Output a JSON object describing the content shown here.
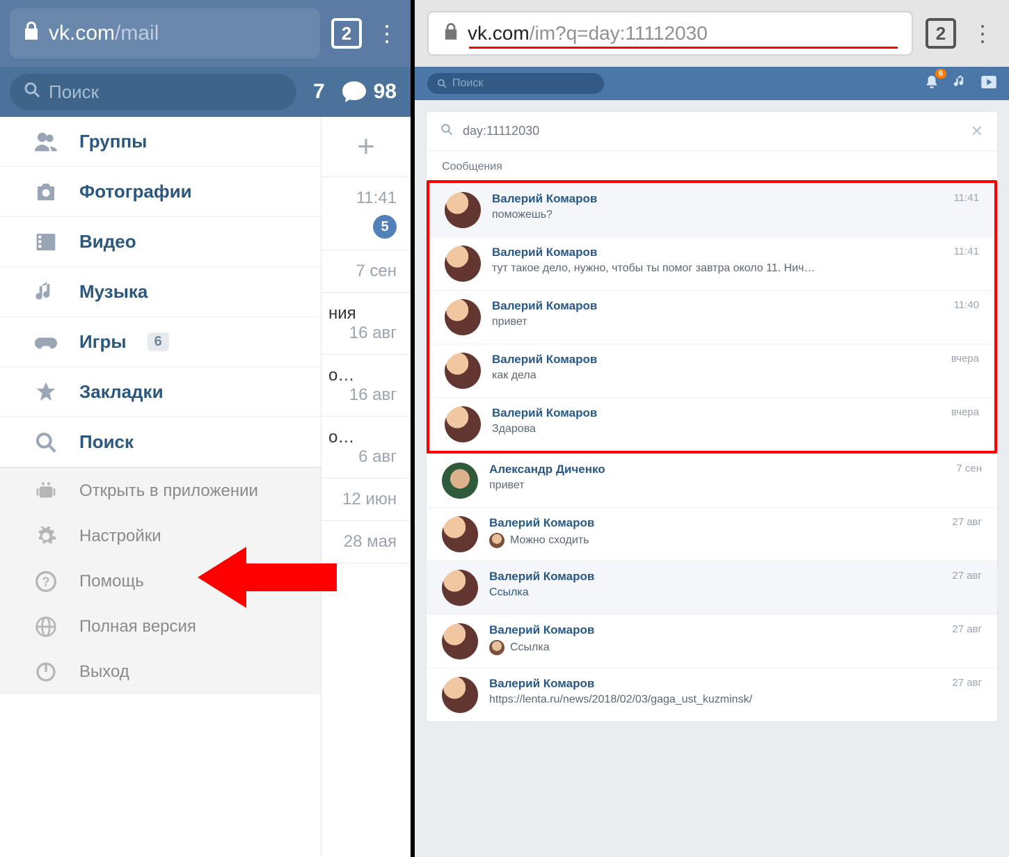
{
  "left": {
    "url": {
      "domain": "vk.com",
      "path": "/mail",
      "tabs": "2"
    },
    "search": {
      "placeholder": "Поиск",
      "friend_req": "7",
      "msg_count": "98"
    },
    "nav": [
      {
        "label": "Группы",
        "icon": "groups"
      },
      {
        "label": "Фотографии",
        "icon": "camera"
      },
      {
        "label": "Видео",
        "icon": "film"
      },
      {
        "label": "Музыка",
        "icon": "music"
      },
      {
        "label": "Игры",
        "icon": "gamepad",
        "badge": "6"
      },
      {
        "label": "Закладки",
        "icon": "star"
      },
      {
        "label": "Поиск",
        "icon": "search"
      }
    ],
    "nav2": [
      {
        "label": "Открыть в приложении",
        "icon": "android"
      },
      {
        "label": "Настройки",
        "icon": "gear"
      },
      {
        "label": "Помощь",
        "icon": "help"
      },
      {
        "label": "Полная версия",
        "icon": "globe"
      },
      {
        "label": "Выход",
        "icon": "power"
      }
    ],
    "chats": [
      {
        "time": "11:41",
        "unread": "5"
      },
      {
        "time": "7 сен"
      },
      {
        "text": "ния",
        "time": "16 авг"
      },
      {
        "text": "о…",
        "time": "16 авг"
      },
      {
        "text": "о…",
        "time": "6 авг"
      },
      {
        "time": "12 июн"
      },
      {
        "time": "28 мая"
      }
    ]
  },
  "right": {
    "url": {
      "domain": "vk.com",
      "path": "/im?q=day:11112030",
      "tabs": "2"
    },
    "topbar": {
      "search": "Поиск",
      "notif_badge": "6"
    },
    "search_query": "day:11112030",
    "section": "Сообщения",
    "messages": [
      {
        "name": "Валерий Комаров",
        "msg": "поможешь?",
        "time": "11:41",
        "alt": true,
        "hl": true
      },
      {
        "name": "Валерий Комаров",
        "msg": "тут такое дело, нужно, чтобы ты помог завтра около 11. Нич…",
        "time": "11:41",
        "hl": true
      },
      {
        "name": "Валерий Комаров",
        "msg": "привет",
        "time": "11:40",
        "hl": true
      },
      {
        "name": "Валерий Комаров",
        "msg": "как дела",
        "time": "вчера",
        "hl": true
      },
      {
        "name": "Валерий Комаров",
        "msg": "Здарова",
        "time": "вчера",
        "hl": true
      },
      {
        "name": "Александр Диченко",
        "msg": "привет",
        "time": "7 сен",
        "av": "green"
      },
      {
        "name": "Валерий Комаров",
        "msg": "Можно сходить",
        "time": "27 авг",
        "mini": true
      },
      {
        "name": "Валерий Комаров",
        "msg": "Ссылка",
        "time": "27 авг",
        "link": true,
        "alt": true
      },
      {
        "name": "Валерий Комаров",
        "msg": "Ссылка",
        "time": "27 авг",
        "mini": true,
        "link": true
      },
      {
        "name": "Валерий Комаров",
        "msg": "https://lenta.ru/news/2018/02/03/gaga_ust_kuzminsk/",
        "time": "27 авг"
      }
    ]
  }
}
